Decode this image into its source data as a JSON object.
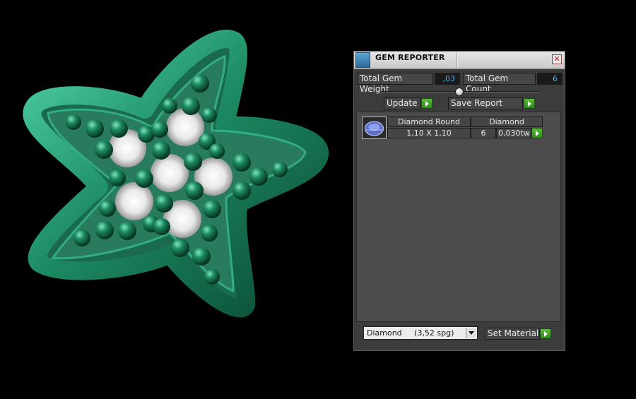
{
  "panel": {
    "title": "GEM REPORTER",
    "close_icon": "close-icon",
    "app_icon": "gem-reporter-icon",
    "total_gem_weight_label": "Total Gem Weight",
    "total_gem_weight_value": ",03",
    "total_gem_count_label": "Total Gem Count",
    "total_gem_count_value": "6",
    "update_label": "Update",
    "save_report_label": "Save Report",
    "gem_row": {
      "shape": "Diamond Round",
      "size": "1,10 X 1,10",
      "material": "Diamond",
      "count": "6",
      "weight": "0,030tw"
    },
    "material_select_value": "Diamond     (3,52 spg)",
    "set_material_label": "Set Material",
    "colors": {
      "accent_value": "#4fb3e8",
      "go_button": "#3fa52a",
      "gem_body": "#1f8a64"
    }
  }
}
